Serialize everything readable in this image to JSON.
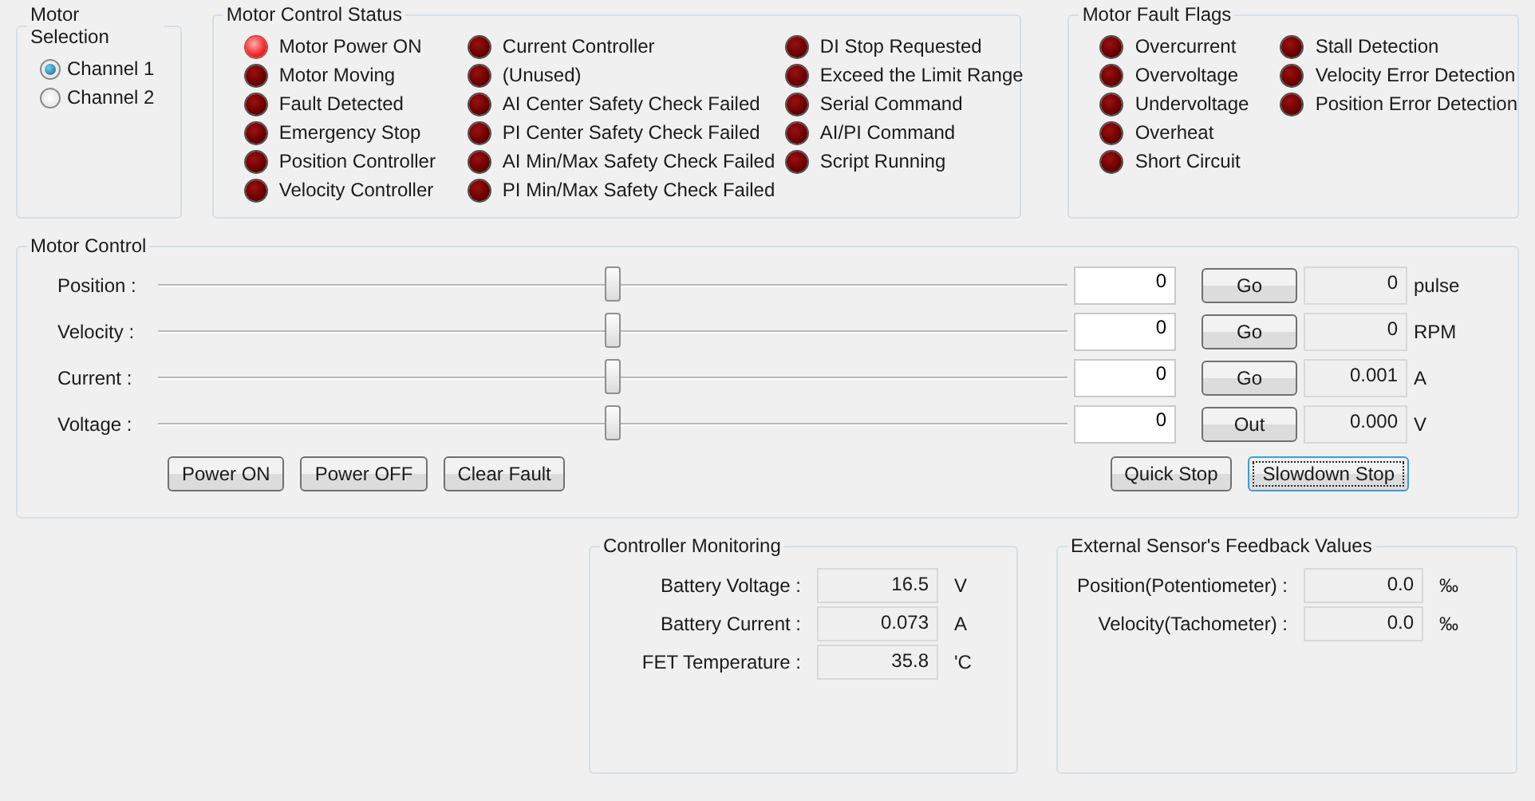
{
  "motor_selection": {
    "title": "Motor Selection",
    "channels": [
      {
        "label": "Channel 1",
        "selected": true
      },
      {
        "label": "Channel 2",
        "selected": false
      }
    ]
  },
  "motor_control_status": {
    "title": "Motor Control Status",
    "columns": [
      [
        {
          "label": "Motor Power ON",
          "on": true
        },
        {
          "label": "Motor Moving",
          "on": false
        },
        {
          "label": "Fault Detected",
          "on": false
        },
        {
          "label": "Emergency Stop",
          "on": false
        },
        {
          "label": "Position Controller",
          "on": false
        },
        {
          "label": "Velocity Controller",
          "on": false
        }
      ],
      [
        {
          "label": "Current Controller",
          "on": false
        },
        {
          "label": "(Unused)",
          "on": false
        },
        {
          "label": "AI Center Safety Check Failed",
          "on": false
        },
        {
          "label": "PI Center Safety Check Failed",
          "on": false
        },
        {
          "label": "AI Min/Max Safety Check Failed",
          "on": false
        },
        {
          "label": "PI Min/Max Safety Check Failed",
          "on": false
        }
      ],
      [
        {
          "label": "DI Stop Requested",
          "on": false
        },
        {
          "label": "Exceed the Limit Range",
          "on": false
        },
        {
          "label": "Serial Command",
          "on": false
        },
        {
          "label": "AI/PI Command",
          "on": false
        },
        {
          "label": "Script Running",
          "on": false
        }
      ]
    ]
  },
  "motor_fault_flags": {
    "title": "Motor Fault Flags",
    "columns": [
      [
        {
          "label": "Overcurrent",
          "on": false
        },
        {
          "label": "Overvoltage",
          "on": false
        },
        {
          "label": "Undervoltage",
          "on": false
        },
        {
          "label": "Overheat",
          "on": false
        },
        {
          "label": "Short Circuit",
          "on": false
        }
      ],
      [
        {
          "label": "Stall Detection",
          "on": false
        },
        {
          "label": "Velocity Error Detection",
          "on": false
        },
        {
          "label": "Position Error Detection",
          "on": false
        }
      ]
    ]
  },
  "motor_control": {
    "title": "Motor Control",
    "rows": [
      {
        "label": "Position :",
        "level": 0.5,
        "input": "0",
        "button": "Go",
        "reading": "0",
        "unit": "pulse"
      },
      {
        "label": "Velocity :",
        "level": 0.5,
        "input": "0",
        "button": "Go",
        "reading": "0",
        "unit": "RPM"
      },
      {
        "label": "Current :",
        "level": 0.5,
        "input": "0",
        "button": "Go",
        "reading": "0.001",
        "unit": "A"
      },
      {
        "label": "Voltage :",
        "level": 0.5,
        "input": "0",
        "button": "Out",
        "reading": "0.000",
        "unit": "V"
      }
    ],
    "left_buttons": [
      {
        "label": "Power ON",
        "focused": false
      },
      {
        "label": "Power OFF",
        "focused": false
      },
      {
        "label": "Clear Fault",
        "focused": false
      }
    ],
    "right_buttons": [
      {
        "label": "Quick Stop",
        "focused": false
      },
      {
        "label": "Slowdown Stop",
        "focused": true
      }
    ]
  },
  "controller_monitoring": {
    "title": "Controller Monitoring",
    "rows": [
      {
        "label": "Battery Voltage :",
        "value": "16.5",
        "unit": "V"
      },
      {
        "label": "Battery Current :",
        "value": "0.073",
        "unit": "A"
      },
      {
        "label": "FET Temperature :",
        "value": "35.8",
        "unit": "'C"
      }
    ]
  },
  "external_sensor": {
    "title": "External Sensor's Feedback Values",
    "rows": [
      {
        "label": "Position(Potentiometer) :",
        "value": "0.0",
        "unit": "‰"
      },
      {
        "label": "Velocity(Tachometer) :",
        "value": "0.0",
        "unit": "‰"
      }
    ]
  }
}
